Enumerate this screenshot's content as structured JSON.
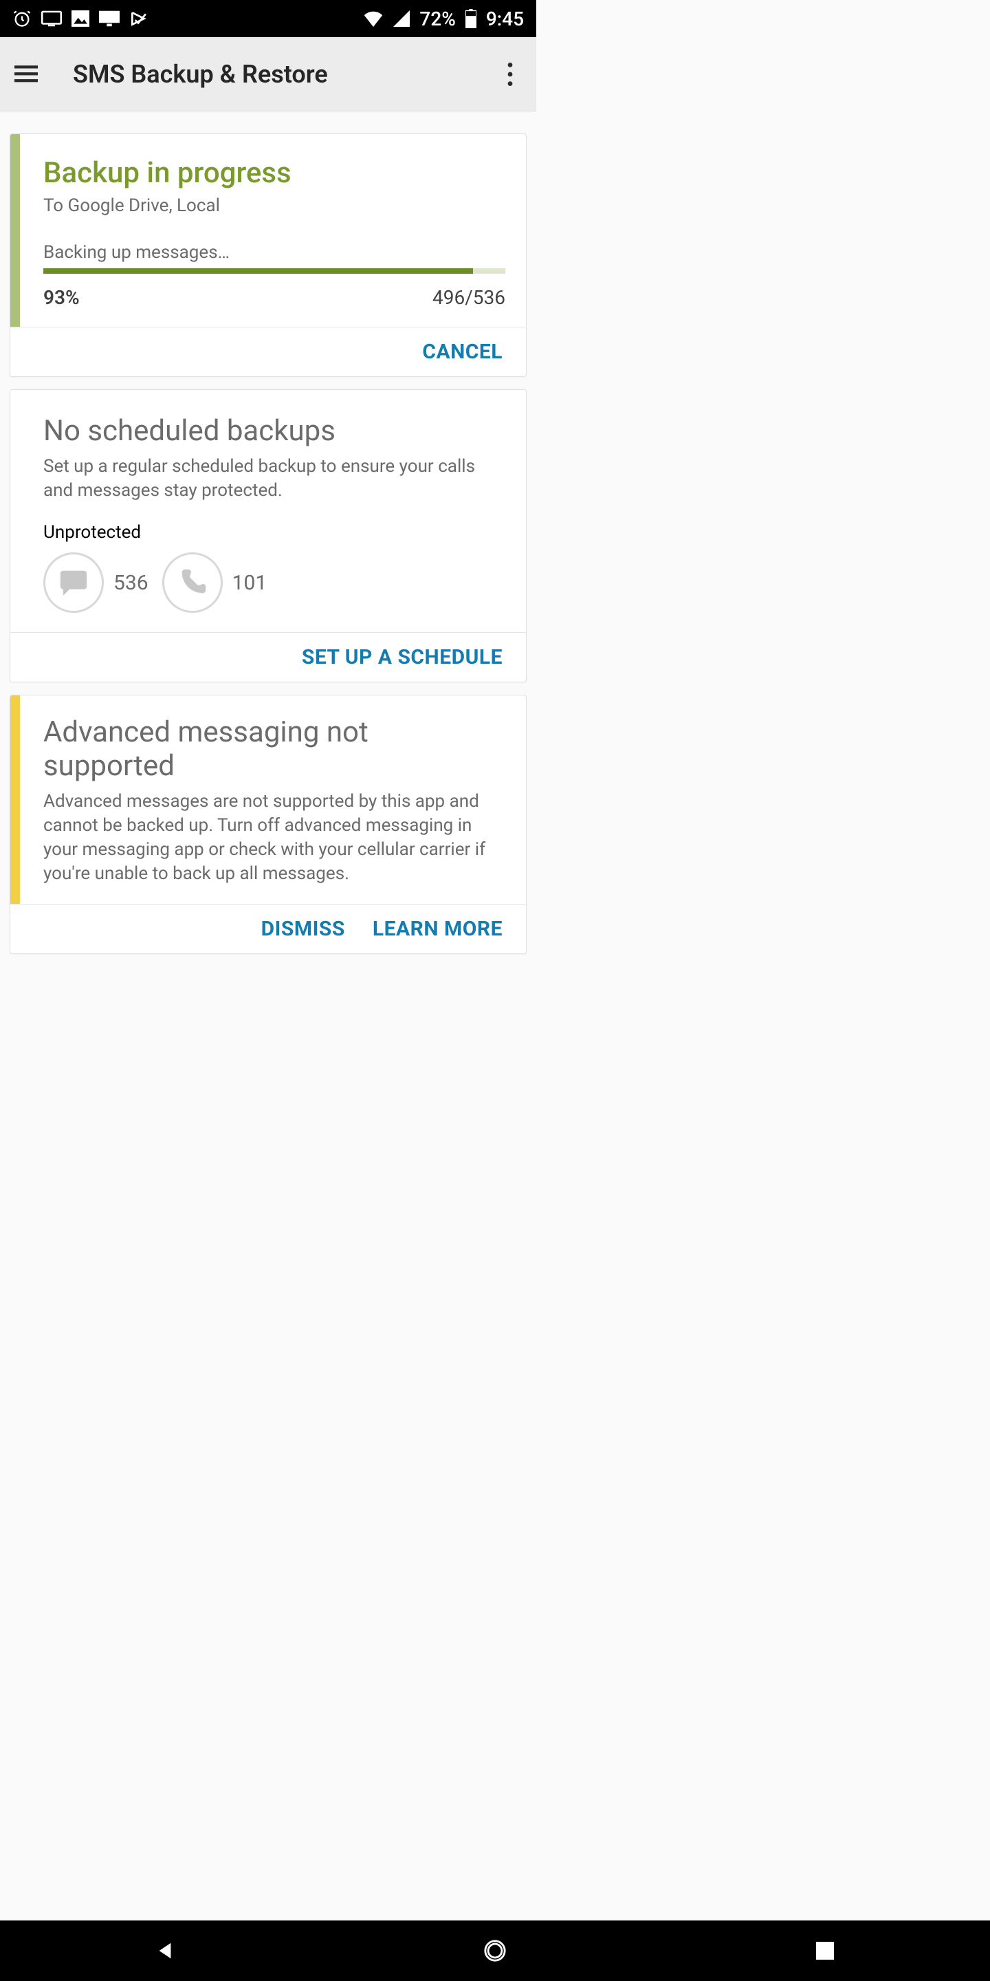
{
  "statusbar": {
    "battery": "72%",
    "time": "9:45"
  },
  "appbar": {
    "title": "SMS Backup & Restore"
  },
  "backup": {
    "title": "Backup in progress",
    "destination": "To Google Drive, Local",
    "status": "Backing up messages…",
    "percent": "93%",
    "progress_pct": 93,
    "count": "496/536",
    "cancel": "CANCEL"
  },
  "schedule": {
    "title": "No scheduled backups",
    "desc": "Set up a regular scheduled backup to ensure your calls and messages stay protected.",
    "label": "Unprotected",
    "messages": "536",
    "calls": "101",
    "action": "SET UP A SCHEDULE"
  },
  "advanced": {
    "title": "Advanced messaging not supported",
    "desc": "Advanced messages are not supported by this app and cannot be backed up. Turn off advanced messaging in your messaging app or check with your cellular carrier if you're unable to back up all messages.",
    "dismiss": "DISMISS",
    "learn": "LEARN MORE"
  }
}
